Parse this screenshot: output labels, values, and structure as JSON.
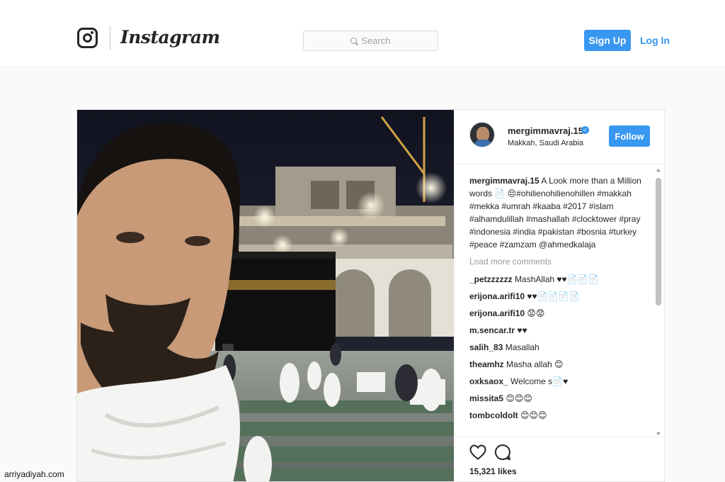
{
  "header": {
    "wordmark": "Instagram",
    "search_placeholder": "Search",
    "signup_label": "Sign Up",
    "login_label": "Log In"
  },
  "post": {
    "username": "mergimmavraj.15",
    "location": "Makkah, Saudi Arabia",
    "follow_label": "Follow",
    "caption_user": "mergimmavraj.15",
    "caption_text": " A Look more than a Million words 📄 😔#ohilienohilienohillen #makkah #mekka #umrah #kaaba #2017 #islam #alhamdulillah #mashallah #clocktower #pray #indonesia #india #pakistan #bosnia #turkey #peace #zamzam @ahmedkalaja",
    "load_more": "Load more comments",
    "comments": [
      {
        "user": "_petzzzzzz",
        "text": " MashAllah ♥♥📄📄📄"
      },
      {
        "user": "erijona.arifi10",
        "text": " ♥♥📄📄📄📄"
      },
      {
        "user": "erijona.arifi10",
        "text": " 😟😟"
      },
      {
        "user": "m.sencar.tr",
        "text": " ♥♥"
      },
      {
        "user": "salih_83",
        "text": " Masallah"
      },
      {
        "user": "theamhz",
        "text": " Masha allah 😊"
      },
      {
        "user": "oxksaox_",
        "text": " Welcome s📄♥"
      },
      {
        "user": "missita5",
        "text": " 😊😊😊"
      },
      {
        "user": "tombcoldolt",
        "text": " 😊😊😊"
      }
    ],
    "likes": "15,321 likes"
  },
  "watermark": "arriyadiyah.com",
  "colors": {
    "accent": "#3897f0",
    "text": "#262626",
    "muted": "#999999"
  },
  "icons": [
    "camera-logo-icon",
    "search-icon",
    "verified-badge-icon",
    "heart-icon",
    "comment-icon"
  ]
}
